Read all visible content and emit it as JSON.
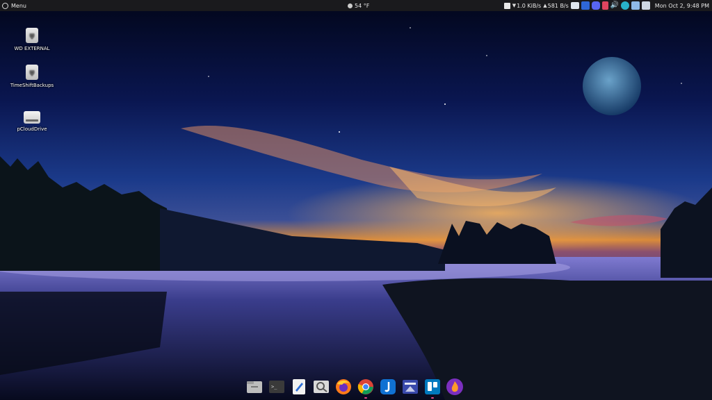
{
  "panel": {
    "menu_label": "Menu",
    "weather": "54 °F",
    "download_speed": "1.0 KiB/s",
    "upload_speed": "581 B/s",
    "clock": "Mon Oct  2,  9:48 PM",
    "tray_icons": [
      "image-icon",
      "bitwarden-icon",
      "discord-icon",
      "flameshot-icon",
      "volume-icon",
      "cloud-check-icon",
      "network-icon",
      "updates-icon"
    ]
  },
  "desktop_icons": [
    {
      "label": "WD EXTERNAL",
      "icon": "usb-drive-icon"
    },
    {
      "label": "TimeShiftBackups",
      "icon": "usb-drive-icon"
    },
    {
      "label": "pCloudDrive",
      "icon": "hard-drive-icon"
    }
  ],
  "dock": {
    "apps": [
      "files-icon",
      "terminal-icon",
      "text-editor-icon",
      "image-viewer-icon",
      "firefox-icon",
      "chrome-icon",
      "joplin-icon",
      "scanner-icon",
      "trello-icon",
      "flame-app-icon"
    ]
  },
  "colors": {
    "panel_bg": "#1a1a1d",
    "dock_indicator": "#e64a8a"
  }
}
